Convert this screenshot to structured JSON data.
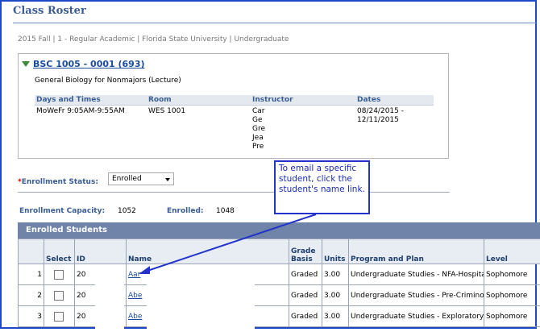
{
  "page": {
    "title": "Class Roster",
    "breadcrumb": "2015 Fall | 1 - Regular Academic | Florida State University | Undergraduate"
  },
  "course": {
    "link": "BSC 1005 - 0001 (693)",
    "description": "General Biology for Nonmajors (Lecture)"
  },
  "meeting": {
    "headers": {
      "days_times": "Days and Times",
      "room": "Room",
      "instructor": "Instructor",
      "dates": "Dates"
    },
    "days_times": "MoWeFr 9:05AM-9:55AM",
    "room": "WES 1001",
    "instructors": [
      "Car",
      "Ge",
      "Gre",
      "Jea",
      "Pre"
    ],
    "dates": [
      "08/24/2015 -",
      "12/11/2015"
    ]
  },
  "enrollment": {
    "required_mark": "*",
    "status_label": "Enrollment Status:",
    "status_value": "Enrolled",
    "capacity_label": "Enrollment Capacity:",
    "capacity_value": "1052",
    "enrolled_label": "Enrolled:",
    "enrolled_value": "1048"
  },
  "tooltip": {
    "text": "To email a specific student, click the student's name link."
  },
  "grid": {
    "title": "Enrolled Students",
    "columns": {
      "select": "Select",
      "id": "ID",
      "name": "Name",
      "grade_basis": "Grade Basis",
      "units": "Units",
      "program": "Program and Plan",
      "level": "Level"
    },
    "rows": [
      {
        "num": "1",
        "id": "20",
        "name": "Aar",
        "grade_basis": "Graded",
        "units": "3.00",
        "program": "Undergraduate Studies - NFA-Hospitality Management",
        "level": "Sophomore"
      },
      {
        "num": "2",
        "id": "20",
        "name": "Abe",
        "grade_basis": "Graded",
        "units": "3.00",
        "program": "Undergraduate Studies - Pre-Criminology",
        "level": "Sophomore"
      },
      {
        "num": "3",
        "id": "20",
        "name": "Abe",
        "grade_basis": "Graded",
        "units": "3.00",
        "program": "Undergraduate Studies - Exploratory I",
        "level": "Sophomore"
      }
    ]
  },
  "colors": {
    "accent": "#3a5d93",
    "link": "#1a4c9f",
    "grid_header": "#6f84a8",
    "frame": "#1b48c4",
    "callout": "#2233cc"
  }
}
